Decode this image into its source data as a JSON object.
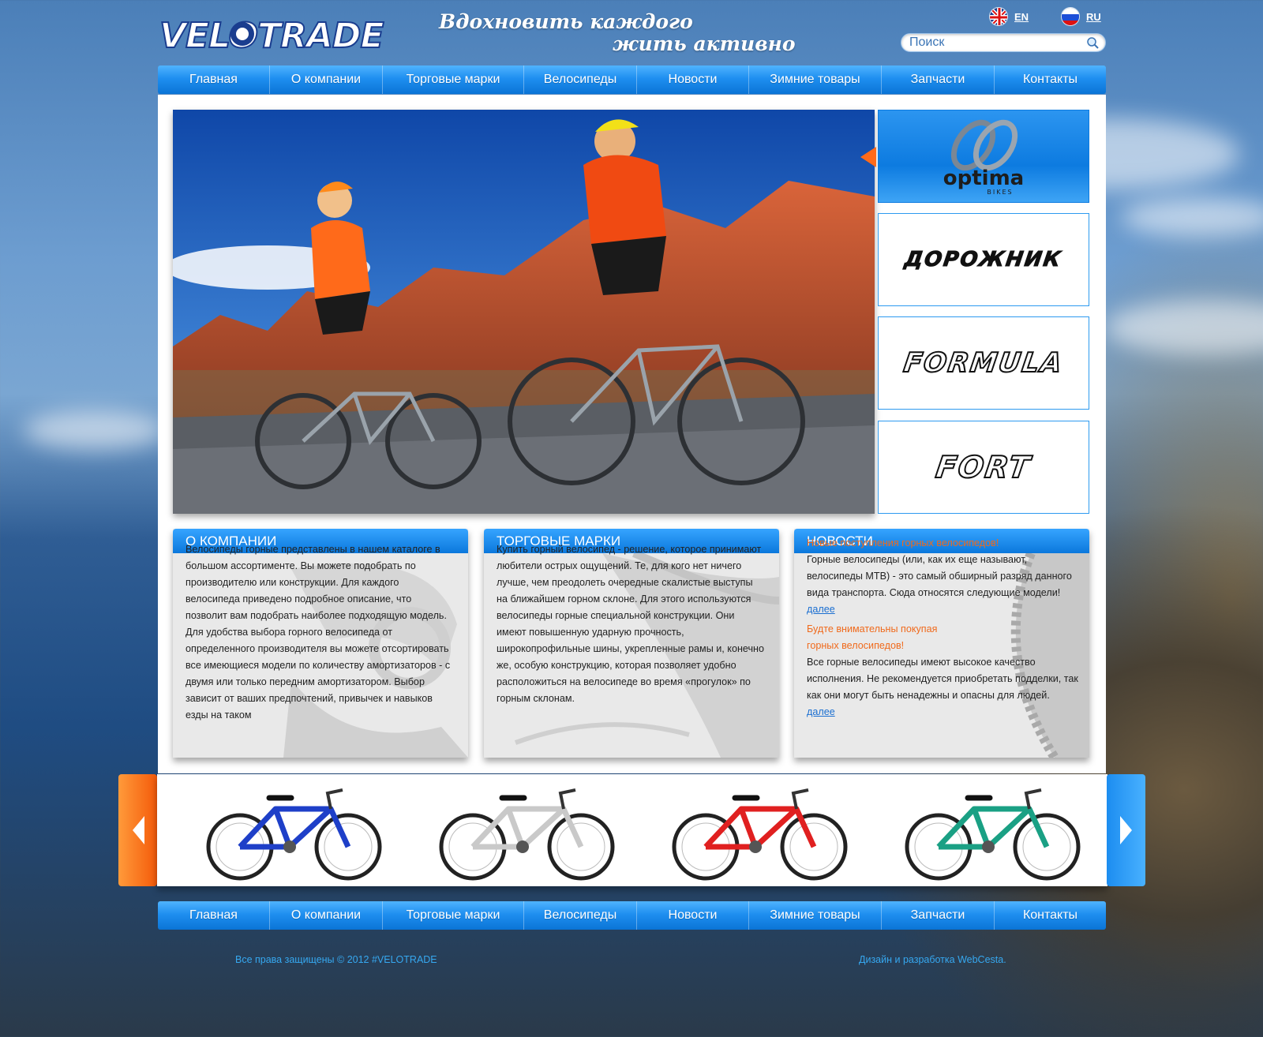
{
  "header": {
    "logo_text": "VELOTRADE",
    "slogan_line1": "Вдохновить каждого",
    "slogan_line2": "жить активно",
    "lang_en": "EN",
    "lang_ru": "RU",
    "search_placeholder": "Поиск"
  },
  "nav": [
    "Главная",
    "О компании",
    "Торговые марки",
    "Велосипеды",
    "Новости",
    "Зимние товары",
    "Запчасти",
    "Контакты"
  ],
  "brands": {
    "optima": "optima",
    "optima_sub": "BIKES",
    "dorozhnik": "ДОРОЖНИК",
    "formula": "FORMULA",
    "fort": "FORT"
  },
  "about": {
    "title": "О КОМПАНИИ",
    "text": "Велосипеды горные представлены в нашем каталоге в большом ассортименте. Вы можете подобрать по производителю или конструкции. Для каждого велосипеда приведено подробное описание, что позволит вам подобрать наиболее подходящую модель. Для удобства выбора горного велосипеда от определенного производителя вы можете отсортировать все имеющиеся модели по количеству амортизаторов - с двумя или только передним амортизатором. Выбор зависит от ваших предпочтений, привычек и навыков езды на таком"
  },
  "trademarks": {
    "title": "ТОРГОВЫЕ МАРКИ",
    "text": "Купить горный велосипед - решение, которое принимают любители острых ощущений. Те, для кого нет ничего лучше, чем преодолеть очередные скалистые выступы на ближайшем горном склоне. Для этого используются велосипеды горные специальной конструкции. Они имеют повышенную ударную прочность, широкопрофильные шины, укрепленные рамы и, конечно же, особую конструкцию, которая позволяет удобно расположиться на велосипеде во время «прогулок» по горным склонам."
  },
  "news": {
    "title": "НОВОСТИ",
    "item1_title": "Новые поступления горных велосипедов!",
    "item1_text": "Горные велосипеды (или, как их еще называют, велосипеды МТВ) - это самый обширный разряд данного вида транспорта. Сюда относятся следующие модели!",
    "item1_more": "далее",
    "item2_title_1": "Будте внимательны покупая",
    "item2_title_2": "горных велосипедов!",
    "item2_text": "Все горные велосипеды имеют высокое качество исполнения. Не рекомендуется приобретать подделки, так как они могут быть ненадежны и опасны для людей.",
    "item2_more": "далее"
  },
  "carousel": {
    "bike_colors": [
      "#1e3fc8",
      "#c9c9c9",
      "#e02020",
      "#1aa084"
    ]
  },
  "footer": {
    "copyright": "Все права защищены © 2012 #VELOTRADE",
    "credits": "Дизайн и разработка WebCesta."
  },
  "colors": {
    "accent_blue": "#0b78dc",
    "accent_orange": "#f06a1c"
  }
}
